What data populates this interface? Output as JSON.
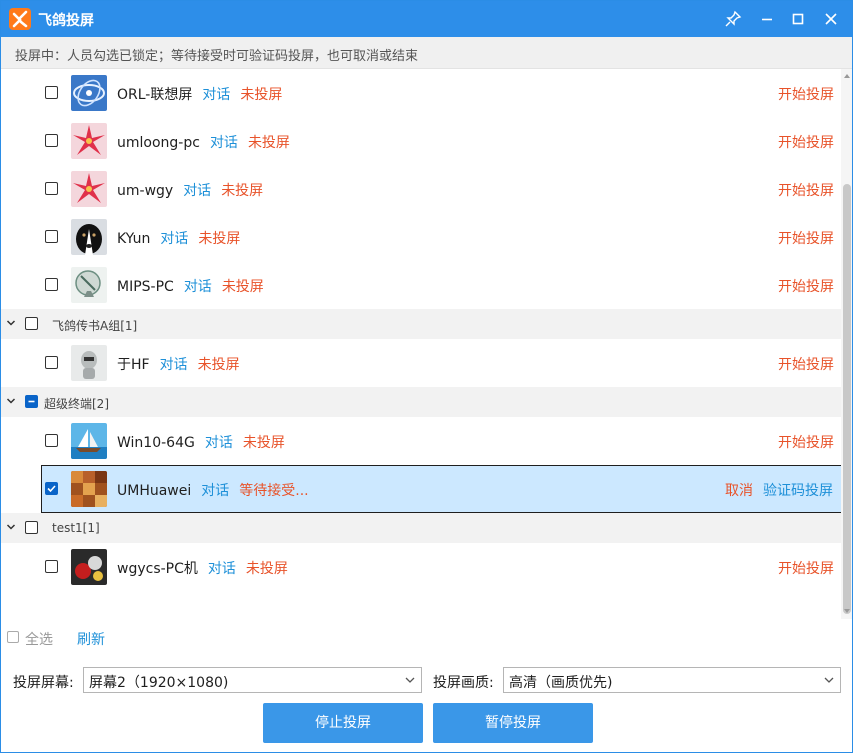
{
  "window": {
    "title": "飞鸽投屏",
    "accent": "#2d8ee9"
  },
  "titlebar_icons": [
    "pin-icon",
    "minimize-icon",
    "maximize-icon",
    "close-icon"
  ],
  "info": {
    "text": "投屏中：人员勾选已锁定；等待接受时可验证码投屏，也可取消或结束"
  },
  "list": {
    "chat_label": "对话",
    "start_label": "开始投屏",
    "rows_top": [
      {
        "name": "ORL-联想屏",
        "status": "未投屏",
        "avatar": "spiral-avatar"
      },
      {
        "name": "umloong-pc",
        "status": "未投屏",
        "avatar": "red-flower-avatar"
      },
      {
        "name": "um-wgy",
        "status": "未投屏",
        "avatar": "red-flower-avatar"
      },
      {
        "name": "KYun",
        "status": "未投屏",
        "avatar": "dog-avatar"
      },
      {
        "name": "MIPS-PC",
        "status": "未投屏",
        "avatar": "satellite-dish-avatar"
      }
    ],
    "groups": [
      {
        "label": "飞鸽传书A组[1]",
        "checked": "none",
        "rows": [
          {
            "name": "于HF",
            "status": "未投屏",
            "avatar": "robot-avatar"
          }
        ]
      },
      {
        "label": "超级终端[2]",
        "checked": "partial",
        "rows": [
          {
            "name": "Win10-64G",
            "status": "未投屏",
            "avatar": "sailboat-avatar"
          },
          {
            "name": "UMHuawei",
            "status": "等待接受...",
            "avatar": "wood-pattern-avatar",
            "selected": true,
            "cancel_label": "取消",
            "verify_label": "验证码投屏"
          }
        ]
      },
      {
        "label": "test1[1]",
        "checked": "none",
        "rows": [
          {
            "name": "wgycs-PC机",
            "status": "未投屏",
            "avatar": "chess-avatar"
          }
        ]
      }
    ]
  },
  "footer": {
    "select_all": "全选",
    "refresh": "刷新",
    "screen_label": "投屏屏幕:",
    "screen_value": "屏幕2（1920×1080)",
    "quality_label": "投屏画质:",
    "quality_value": "高清（画质优先)",
    "stop_button": "停止投屏",
    "pause_button": "暂停投屏"
  },
  "colors": {
    "link": "#1e90d8",
    "action": "#e8532a",
    "selected_row": "#cce8ff",
    "button": "#3a97e8"
  }
}
